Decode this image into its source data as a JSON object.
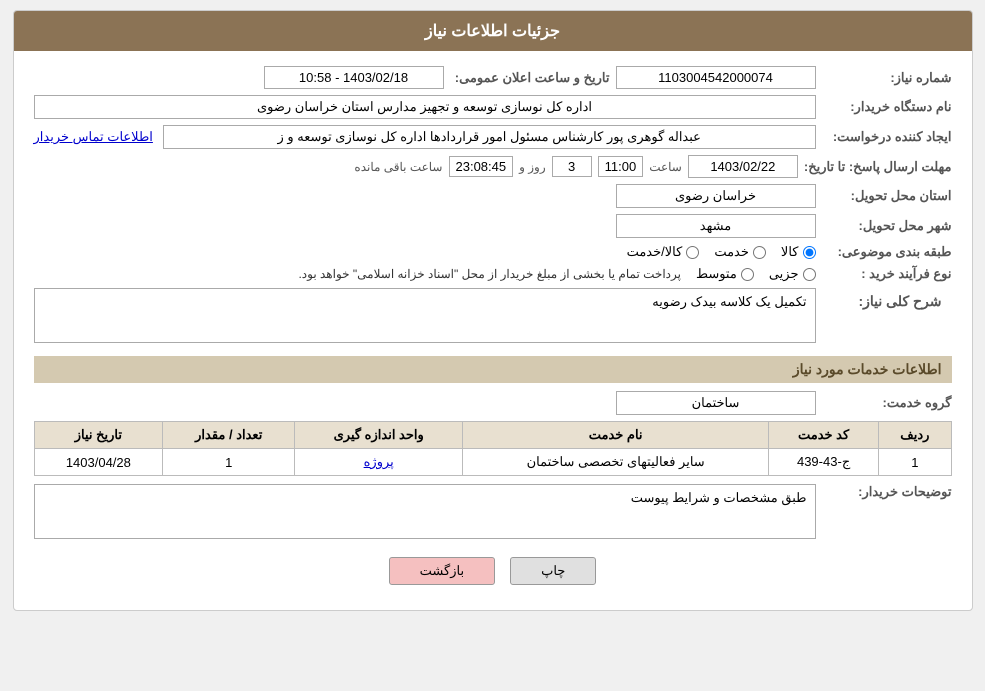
{
  "header": {
    "title": "جزئیات اطلاعات نیاز"
  },
  "fields": {
    "shomara_niaz_label": "شماره نیاز:",
    "shomara_niaz_value": "1103004542000074",
    "nam_dastgah_label": "نام دستگاه خریدار:",
    "nam_dastgah_value": "اداره کل نوسازی  توسعه و تجهیز مدارس استان خراسان رضوی",
    "ijad_label": "ایجاد کننده درخواست:",
    "ijad_value": "عبداله گوهری پور کارشناس مسئول امور قراردادها  اداره کل نوسازی  توسعه و ز",
    "ijad_link": "اطلاعات تماس خریدار",
    "mohlet_label": "مهلت ارسال پاسخ: تا تاریخ:",
    "mohlet_date": "1403/02/22",
    "mohlet_saat_label": "ساعت",
    "mohlet_saat": "11:00",
    "mohlet_rooz_label": "روز و",
    "mohlet_rooz": "3",
    "mohlet_baqi_label": "ساعت باقی مانده",
    "mohlet_baqi": "23:08:45",
    "ostan_label": "استان محل تحویل:",
    "ostan_value": "خراسان رضوی",
    "shahr_label": "شهر محل تحویل:",
    "shahr_value": "مشهد",
    "tabaqe_label": "طبقه بندی موضوعی:",
    "tabaqe_options": [
      "کالا",
      "خدمت",
      "کالا/خدمت"
    ],
    "tabaqe_selected": "کالا",
    "noe_farayand_label": "نوع فرآیند خرید :",
    "noe_farayand_options": [
      "جزیی",
      "متوسط"
    ],
    "noe_farayand_note": "پرداخت تمام یا بخشی از مبلغ خریدار از محل \"اسناد خزانه اسلامی\" خواهد بود.",
    "sharh_label": "شرح کلی نیاز:",
    "sharh_value": "تکمیل یک کلاسه بیدک رضویه",
    "khadamat_header": "اطلاعات خدمات مورد نیاز",
    "grooh_label": "گروه خدمت:",
    "grooh_value": "ساختمان",
    "table": {
      "columns": [
        "ردیف",
        "کد خدمت",
        "نام خدمت",
        "واحد اندازه گیری",
        "تعداد / مقدار",
        "تاریخ نیاز"
      ],
      "rows": [
        {
          "radif": "1",
          "kod": "ج-43-439",
          "nam": "سایر فعالیتهای تخصصی ساختمان",
          "vahed": "پروژه",
          "tedad": "1",
          "tarikh": "1403/04/28"
        }
      ]
    },
    "tozihat_label": "توضیحات خریدار:",
    "tozihat_value": "طبق مشخصات و شرایط پیوست",
    "btn_print": "چاپ",
    "btn_back": "بازگشت",
    "tarikh_label": "تاریخ و ساعت اعلان عمومی:",
    "tarikh_value": "1403/02/18 - 10:58"
  }
}
